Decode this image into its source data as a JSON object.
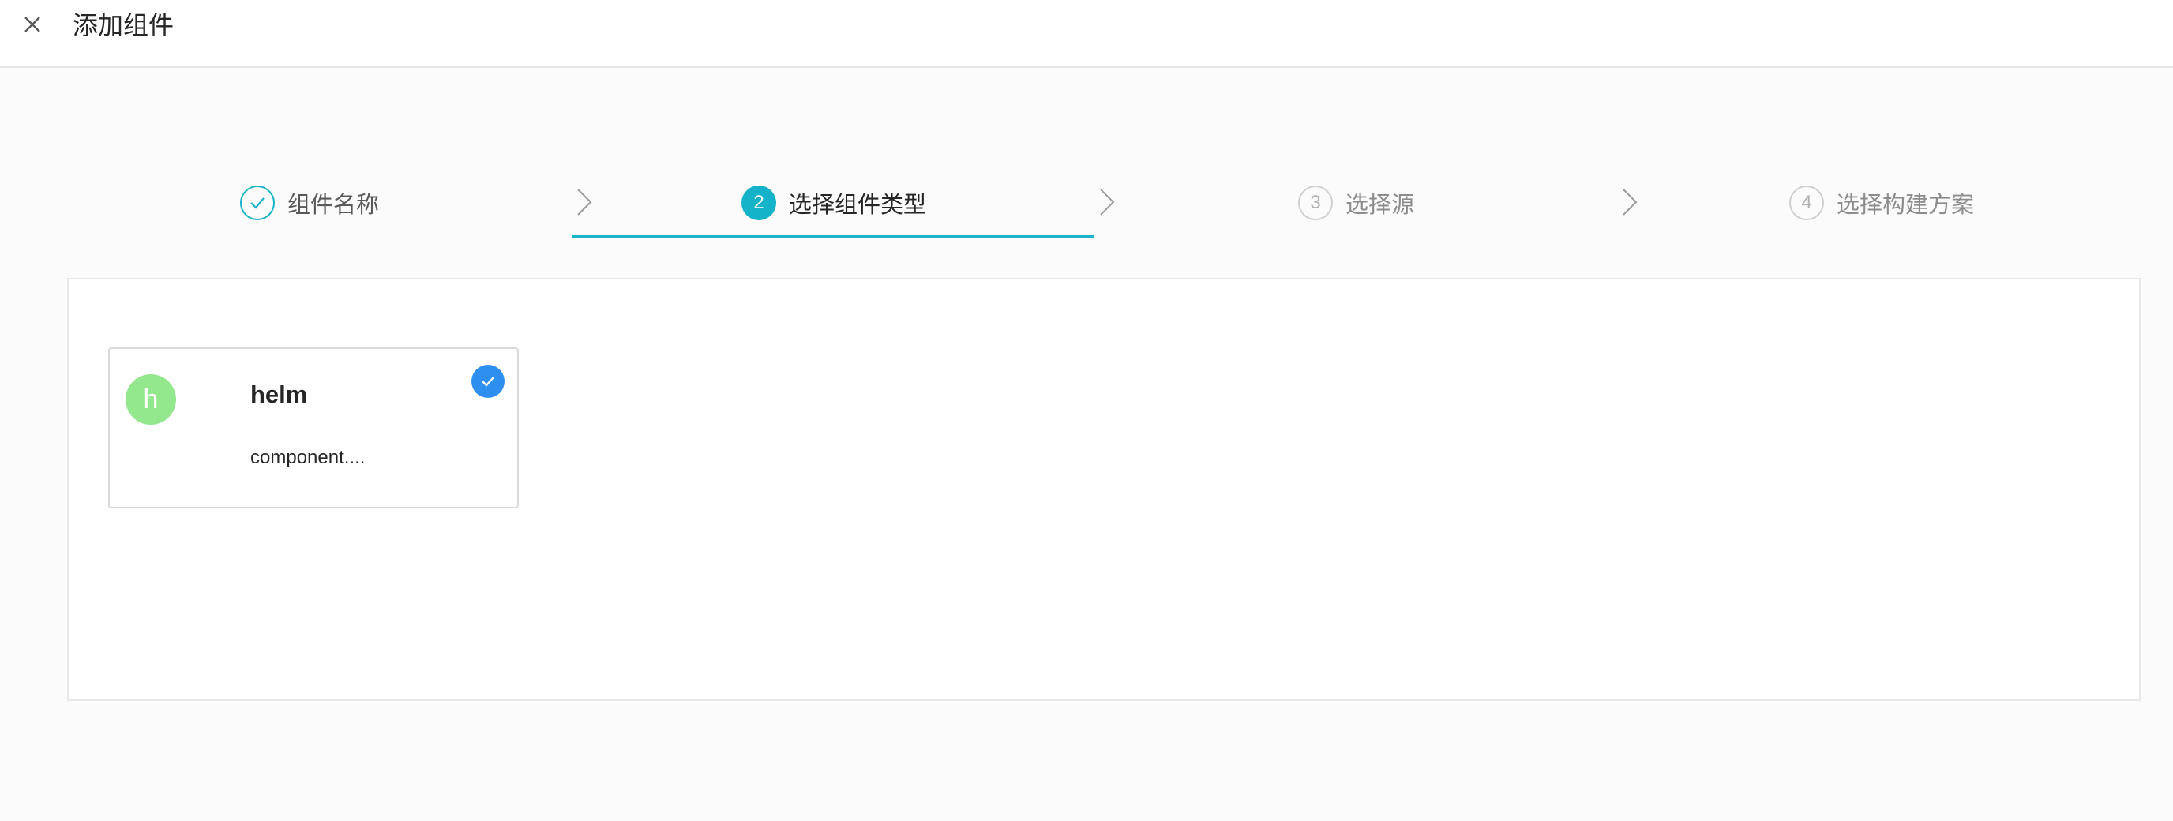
{
  "header": {
    "title": "添加组件",
    "close_icon": "close-icon"
  },
  "steps": [
    {
      "number": "",
      "label": "组件名称",
      "state": "done",
      "icon": "check-icon"
    },
    {
      "number": "2",
      "label": "选择组件类型",
      "state": "active"
    },
    {
      "number": "3",
      "label": "选择源",
      "state": "pending"
    },
    {
      "number": "4",
      "label": "选择构建方案",
      "state": "pending"
    }
  ],
  "component_card": {
    "avatar_letter": "h",
    "name": "helm",
    "description": "component....",
    "selected": true,
    "avatar_color": "#93e78c"
  },
  "colors": {
    "accent": "#1ab3c7",
    "selected_check": "#2f8ff0"
  }
}
